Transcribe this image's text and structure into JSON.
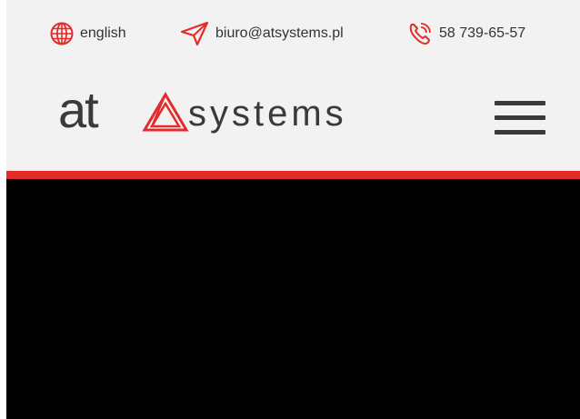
{
  "topbar": {
    "language": {
      "label": "english",
      "icon": "globe-icon"
    },
    "email": {
      "label": "biuro@atsystems.pl",
      "icon": "paper-plane-icon"
    },
    "phone": {
      "label": "58 739-65-57",
      "icon": "phone-icon"
    }
  },
  "logo": {
    "at_text": "at",
    "systems_text": "systems"
  },
  "navigation": {
    "menu_icon": "hamburger-menu-icon"
  },
  "colors": {
    "accent": "#e52a2a",
    "header_background": "#f2f2f2",
    "text": "#333333",
    "hero_background": "#000000"
  }
}
